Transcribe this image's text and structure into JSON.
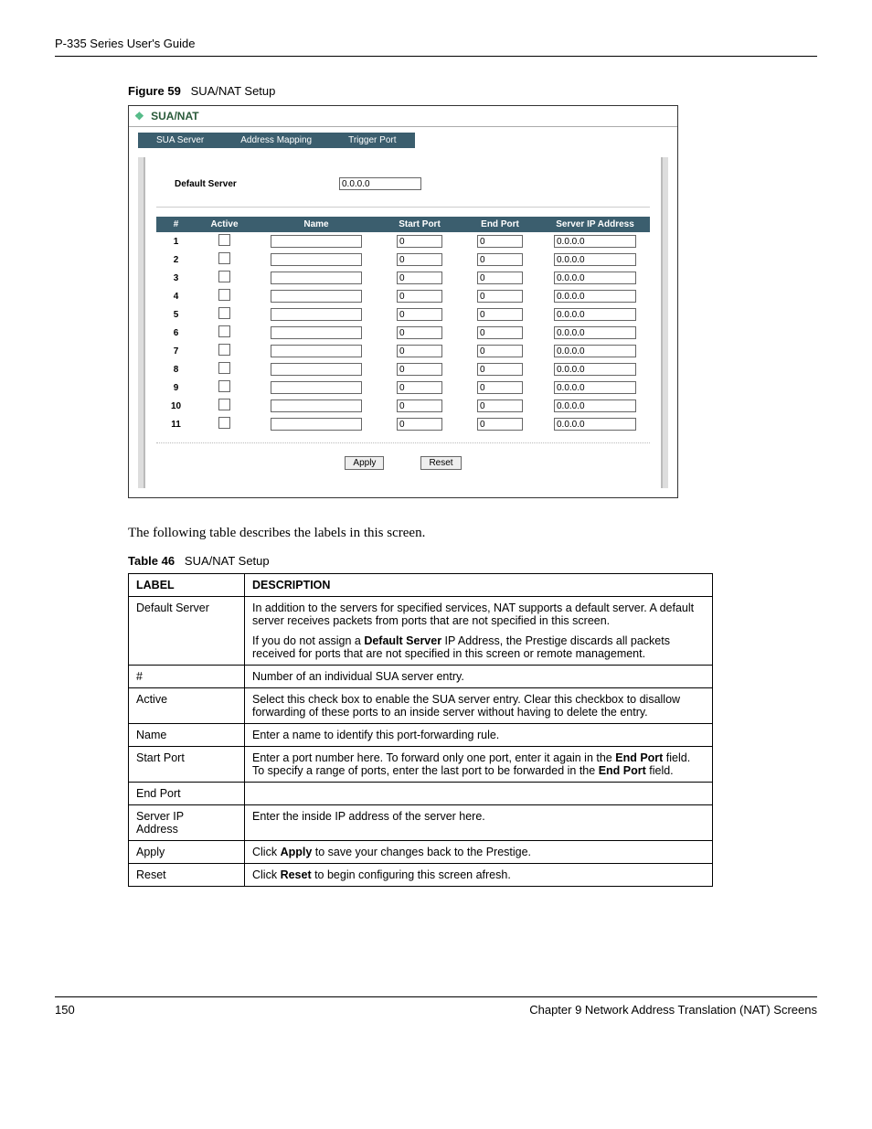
{
  "header": {
    "guide": "P-335 Series User's Guide"
  },
  "figure": {
    "label": "Figure 59",
    "title": "SUA/NAT Setup",
    "ss": {
      "title": "SUA/NAT",
      "tabs": [
        "SUA Server",
        "Address Mapping",
        "Trigger Port"
      ],
      "default_server_label": "Default Server",
      "default_server_value": "0.0.0.0",
      "cols": {
        "num": "#",
        "active": "Active",
        "name": "Name",
        "start": "Start Port",
        "end": "End Port",
        "ip": "Server IP Address"
      },
      "rows": [
        {
          "n": "1",
          "start": "0",
          "end": "0",
          "ip": "0.0.0.0"
        },
        {
          "n": "2",
          "start": "0",
          "end": "0",
          "ip": "0.0.0.0"
        },
        {
          "n": "3",
          "start": "0",
          "end": "0",
          "ip": "0.0.0.0"
        },
        {
          "n": "4",
          "start": "0",
          "end": "0",
          "ip": "0.0.0.0"
        },
        {
          "n": "5",
          "start": "0",
          "end": "0",
          "ip": "0.0.0.0"
        },
        {
          "n": "6",
          "start": "0",
          "end": "0",
          "ip": "0.0.0.0"
        },
        {
          "n": "7",
          "start": "0",
          "end": "0",
          "ip": "0.0.0.0"
        },
        {
          "n": "8",
          "start": "0",
          "end": "0",
          "ip": "0.0.0.0"
        },
        {
          "n": "9",
          "start": "0",
          "end": "0",
          "ip": "0.0.0.0"
        },
        {
          "n": "10",
          "start": "0",
          "end": "0",
          "ip": "0.0.0.0"
        },
        {
          "n": "11",
          "start": "0",
          "end": "0",
          "ip": "0.0.0.0"
        }
      ],
      "apply": "Apply",
      "reset": "Reset"
    }
  },
  "intro": "The following table describes the labels in this screen.",
  "table": {
    "label": "Table 46",
    "title": "SUA/NAT Setup",
    "head": {
      "label": "LABEL",
      "desc": "DESCRIPTION"
    },
    "rows": {
      "default_server": {
        "label": "Default Server",
        "p1": "In addition to the servers for specified services, NAT supports a default server. A default server receives packets from ports that are not specified in this screen.",
        "p2a": "If you do not assign a ",
        "p2b": "Default Server",
        "p2c": " IP Address, the Prestige discards all packets received for ports that are not specified in this screen or remote management."
      },
      "hash": {
        "label": "#",
        "desc": "Number of an individual SUA server entry."
      },
      "active": {
        "label": "Active",
        "desc": "Select this check box to enable the SUA server entry. Clear this checkbox to disallow forwarding of these ports to an inside server without having to delete the entry."
      },
      "name": {
        "label": "Name",
        "desc": "Enter a name to identify this port-forwarding rule."
      },
      "start_port": {
        "label": "Start Port",
        "p_a": "Enter a port number here. To forward only one port, enter it again in the ",
        "p_b": "End Port",
        "p_c": " field. To specify a range of ports, enter the last port to be forwarded in the ",
        "p_d": "End Port",
        "p_e": " field."
      },
      "end_port": {
        "label": "End Port",
        "desc": ""
      },
      "server_ip": {
        "label_l1": "Server IP",
        "label_l2": "Address",
        "desc": "Enter the inside IP address of the server here."
      },
      "apply": {
        "label": "Apply",
        "p_a": "Click ",
        "p_b": "Apply",
        "p_c": " to save your changes back to the Prestige."
      },
      "reset": {
        "label": "Reset",
        "p_a": "Click ",
        "p_b": "Reset",
        "p_c": " to begin configuring this screen afresh."
      }
    }
  },
  "footer": {
    "page": "150",
    "chapter": "Chapter 9 Network Address Translation (NAT) Screens"
  }
}
